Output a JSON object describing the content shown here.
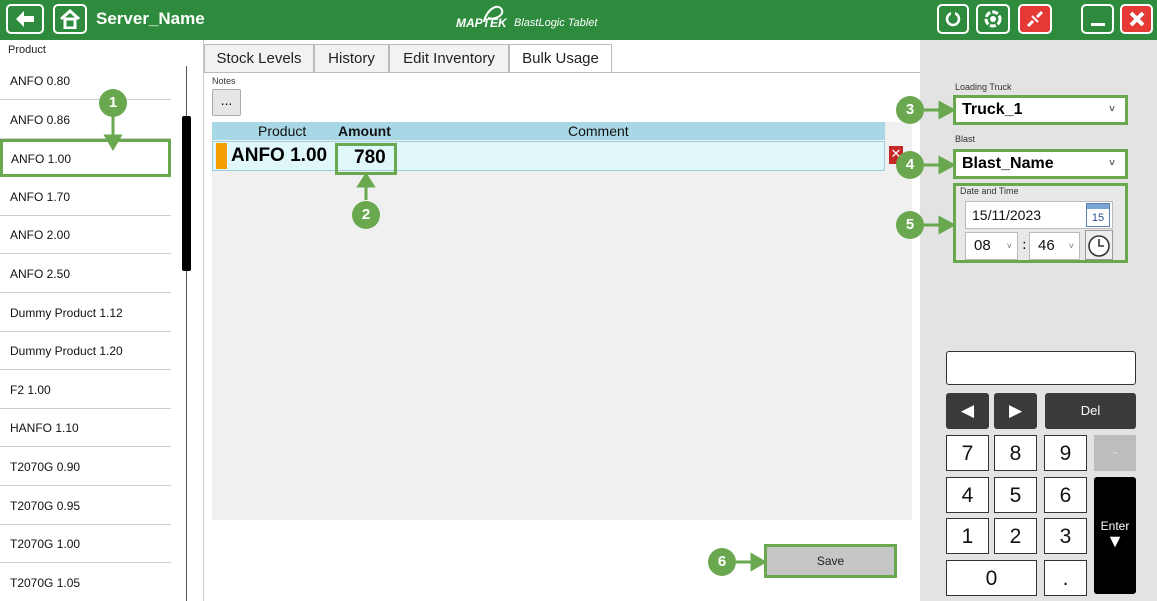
{
  "titlebar": {
    "server_name": "Server_Name",
    "brand_logo": "MAPTEK",
    "brand_app": "BlastLogic Tablet"
  },
  "product_list": {
    "header": "Product",
    "items": [
      {
        "label": "ANFO 0.80"
      },
      {
        "label": "ANFO 0.86"
      },
      {
        "label": "ANFO 1.00",
        "selected": true
      },
      {
        "label": "ANFO 1.70"
      },
      {
        "label": "ANFO 2.00"
      },
      {
        "label": "ANFO 2.50"
      },
      {
        "label": "Dummy Product 1.12"
      },
      {
        "label": "Dummy Product 1.20"
      },
      {
        "label": "F2 1.00"
      },
      {
        "label": "HANFO 1.10"
      },
      {
        "label": "T2070G 0.90"
      },
      {
        "label": "T2070G 0.95"
      },
      {
        "label": "T2070G 1.00"
      },
      {
        "label": "T2070G 1.05"
      }
    ]
  },
  "tabs": [
    {
      "label": "Stock Levels"
    },
    {
      "label": "History"
    },
    {
      "label": "Edit Inventory"
    },
    {
      "label": "Bulk Usage",
      "active": true
    }
  ],
  "notes": {
    "label": "Notes",
    "button": "..."
  },
  "grid": {
    "columns": {
      "product": "Product",
      "amount": "Amount",
      "comment": "Comment"
    },
    "rows": [
      {
        "product": "ANFO 1.00",
        "amount": "780",
        "comment": ""
      }
    ]
  },
  "right_panel": {
    "loading_truck": {
      "label": "Loading Truck",
      "value": "Truck_1"
    },
    "blast": {
      "label": "Blast",
      "value": "Blast_Name"
    },
    "date_time": {
      "label": "Date and Time",
      "date": "15/11/2023",
      "calendar_day": "15",
      "hour": "08",
      "minute": "46",
      "separator": ":"
    }
  },
  "keypad": {
    "left": "◀",
    "right": "▶",
    "del": "Del",
    "k7": "7",
    "k8": "8",
    "k9": "9",
    "minus": "-",
    "k4": "4",
    "k5": "5",
    "k6": "6",
    "k1": "1",
    "k2": "2",
    "k3": "3",
    "k0": "0",
    "dot": ".",
    "enter": "Enter",
    "enter_arrow": "▼"
  },
  "save_label": "Save",
  "callouts": [
    "1",
    "2",
    "3",
    "4",
    "5",
    "6"
  ],
  "colors": {
    "title_green": "#2e8b3e",
    "callout_green": "#6aa84f",
    "close_red": "#e53935",
    "row_marker": "#f5a000",
    "grid_header": "#a8d8e6"
  },
  "icons": [
    "back-arrow-icon",
    "home-icon",
    "sync-icon",
    "settings-icon",
    "disconnect-icon",
    "minimize-icon",
    "close-icon",
    "calendar-icon",
    "clock-icon"
  ]
}
